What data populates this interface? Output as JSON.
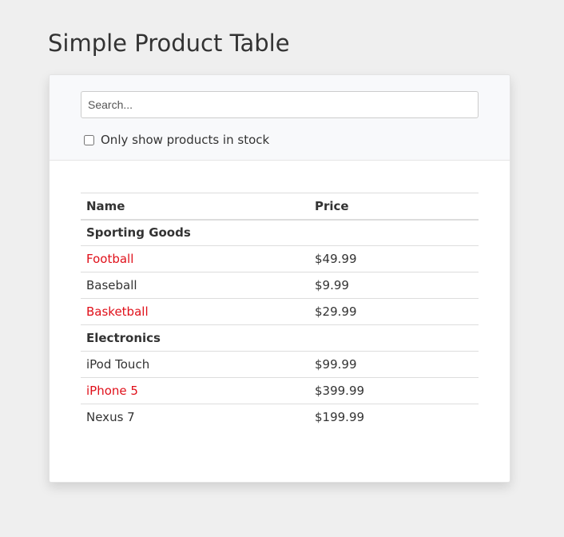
{
  "page": {
    "title": "Simple Product Table"
  },
  "search": {
    "placeholder": "Search...",
    "value": "",
    "stock_label": "Only show products in stock"
  },
  "table": {
    "headers": {
      "name": "Name",
      "price": "Price"
    },
    "categories": [
      {
        "name": "Sporting Goods",
        "products": [
          {
            "name": "Football",
            "price": "$49.99",
            "stocked": false
          },
          {
            "name": "Baseball",
            "price": "$9.99",
            "stocked": true
          },
          {
            "name": "Basketball",
            "price": "$29.99",
            "stocked": false
          }
        ]
      },
      {
        "name": "Electronics",
        "products": [
          {
            "name": "iPod Touch",
            "price": "$99.99",
            "stocked": true
          },
          {
            "name": "iPhone 5",
            "price": "$399.99",
            "stocked": false
          },
          {
            "name": "Nexus 7",
            "price": "$199.99",
            "stocked": true
          }
        ]
      }
    ]
  },
  "colors": {
    "out_of_stock": "#e0101a",
    "background": "#efefef",
    "card_header": "#f8f9fb"
  }
}
